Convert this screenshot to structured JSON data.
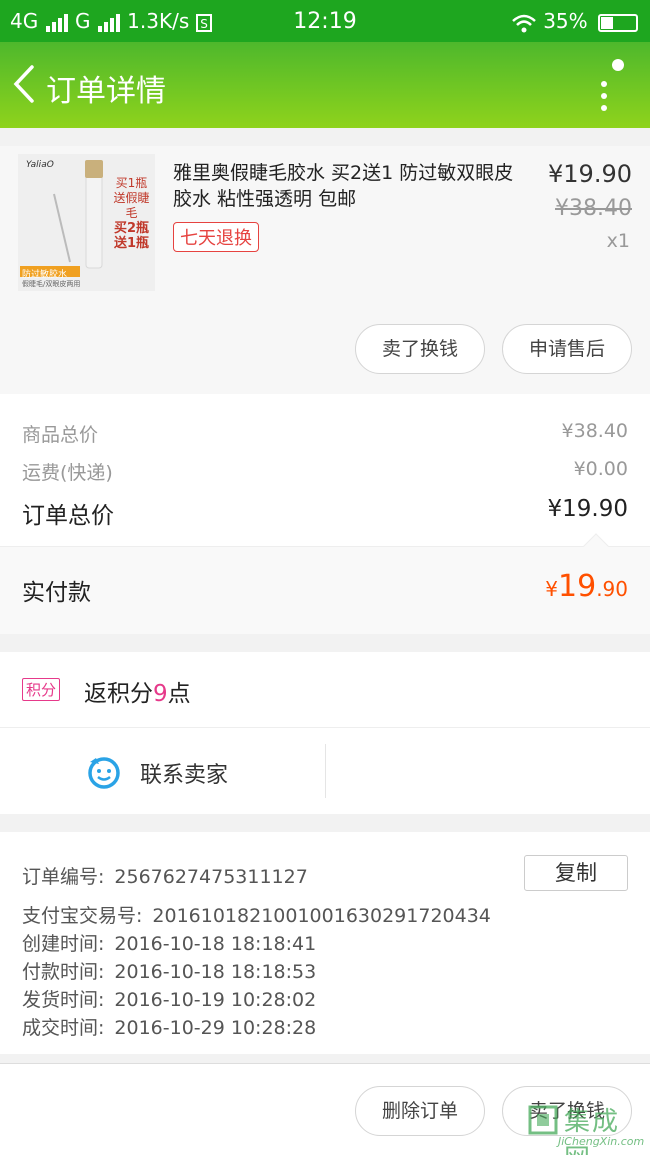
{
  "status_bar": {
    "network1": "4G",
    "network2": "G",
    "speed": "1.3K/s",
    "time": "12:19",
    "battery_text": "35%",
    "battery_level": 0.35
  },
  "nav": {
    "title": "订单详情",
    "back_icon": "back-arrow-icon",
    "more_icon": "more-vertical-icon"
  },
  "product": {
    "name": "雅里奥假睫毛胶水 买2送1 防过敏双眼皮胶水 粘性强透明 包邮",
    "tag": "七天退换",
    "price": "¥19.90",
    "original_price": "¥38.40",
    "quantity": "x1",
    "thumb_texts": {
      "line1": "买1瓶",
      "line2": "送假睫毛",
      "line3": "买2瓶",
      "line4": "送1瓶",
      "band": "防过敏胶水",
      "sub": "假睫毛/双眼皮两用"
    },
    "buttons": {
      "sell": "卖了换钱",
      "after_sale": "申请售后"
    }
  },
  "costs": {
    "goods_total_label": "商品总价",
    "goods_total_value": "¥38.40",
    "shipping_label": "运费(快递)",
    "shipping_value": "¥0.00",
    "order_total_label": "订单总价",
    "order_total_value": "¥19.90",
    "paid_label": "实付款",
    "paid_currency": "¥",
    "paid_int": "19",
    "paid_dec": ".90"
  },
  "points": {
    "badge": "积分",
    "prefix": "返积分",
    "number": "9",
    "suffix": "点"
  },
  "contact": {
    "label": "联系卖家",
    "icon": "chat-face-icon"
  },
  "order_info": {
    "order_no_label": "订单编号:",
    "order_no": "2567627475311127",
    "copy_label": "复制",
    "alipay_label": "支付宝交易号:",
    "alipay_no": "2016101821001001630291720434",
    "created_label": "创建时间:",
    "created": "2016-10-18 18:18:41",
    "paid_label": "付款时间:",
    "paid": "2016-10-18 18:18:53",
    "shipped_label": "发货时间:",
    "shipped": "2016-10-19 10:28:02",
    "done_label": "成交时间:",
    "done": "2016-10-29 10:28:28"
  },
  "footer": {
    "delete_label": "删除订单",
    "sell_label": "卖了换钱"
  },
  "watermark": {
    "text": "集成网",
    "url": "JiChengXin.com"
  }
}
